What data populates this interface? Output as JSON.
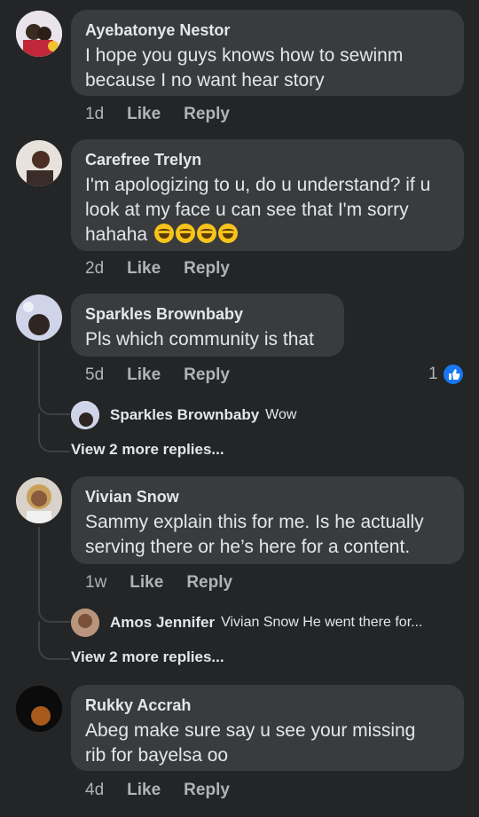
{
  "actions_labels": {
    "like": "Like",
    "reply": "Reply"
  },
  "comments": [
    {
      "author": "Ayebatonye Nestor",
      "lines": [
        "I hope you guys knows how to sewinm",
        "because I no want hear story"
      ],
      "time": "1d"
    },
    {
      "author": "Carefree Trelyn",
      "lines": [
        "I'm apologizing to u, do u understand? if u",
        "look at my face u can see that I'm sorry",
        "hahaha"
      ],
      "emoji_count": 4,
      "time": "2d"
    },
    {
      "author": "Sparkles Brownbaby",
      "lines": [
        "Pls which community is that"
      ],
      "time": "5d",
      "reaction_count": "1",
      "reply": {
        "author": "Sparkles Brownbaby",
        "text": "Wow"
      },
      "more_replies": "View 2 more replies..."
    },
    {
      "author": "Vivian Snow",
      "lines": [
        "Sammy explain this for me. Is he actually",
        "serving there or he’s here for a content."
      ],
      "time": "1w",
      "reply": {
        "author": "Amos Jennifer",
        "text": "Vivian Snow He went there for..."
      },
      "more_replies": "View 2 more replies..."
    },
    {
      "author": "Rukky Accrah",
      "lines": [
        "Abeg make sure say u see your missing",
        "rib for bayelsa oo"
      ],
      "time": "4d"
    }
  ],
  "colors": {
    "background": "#242526",
    "bubble": "#3a3b3c",
    "like_badge": "#1877f2"
  }
}
